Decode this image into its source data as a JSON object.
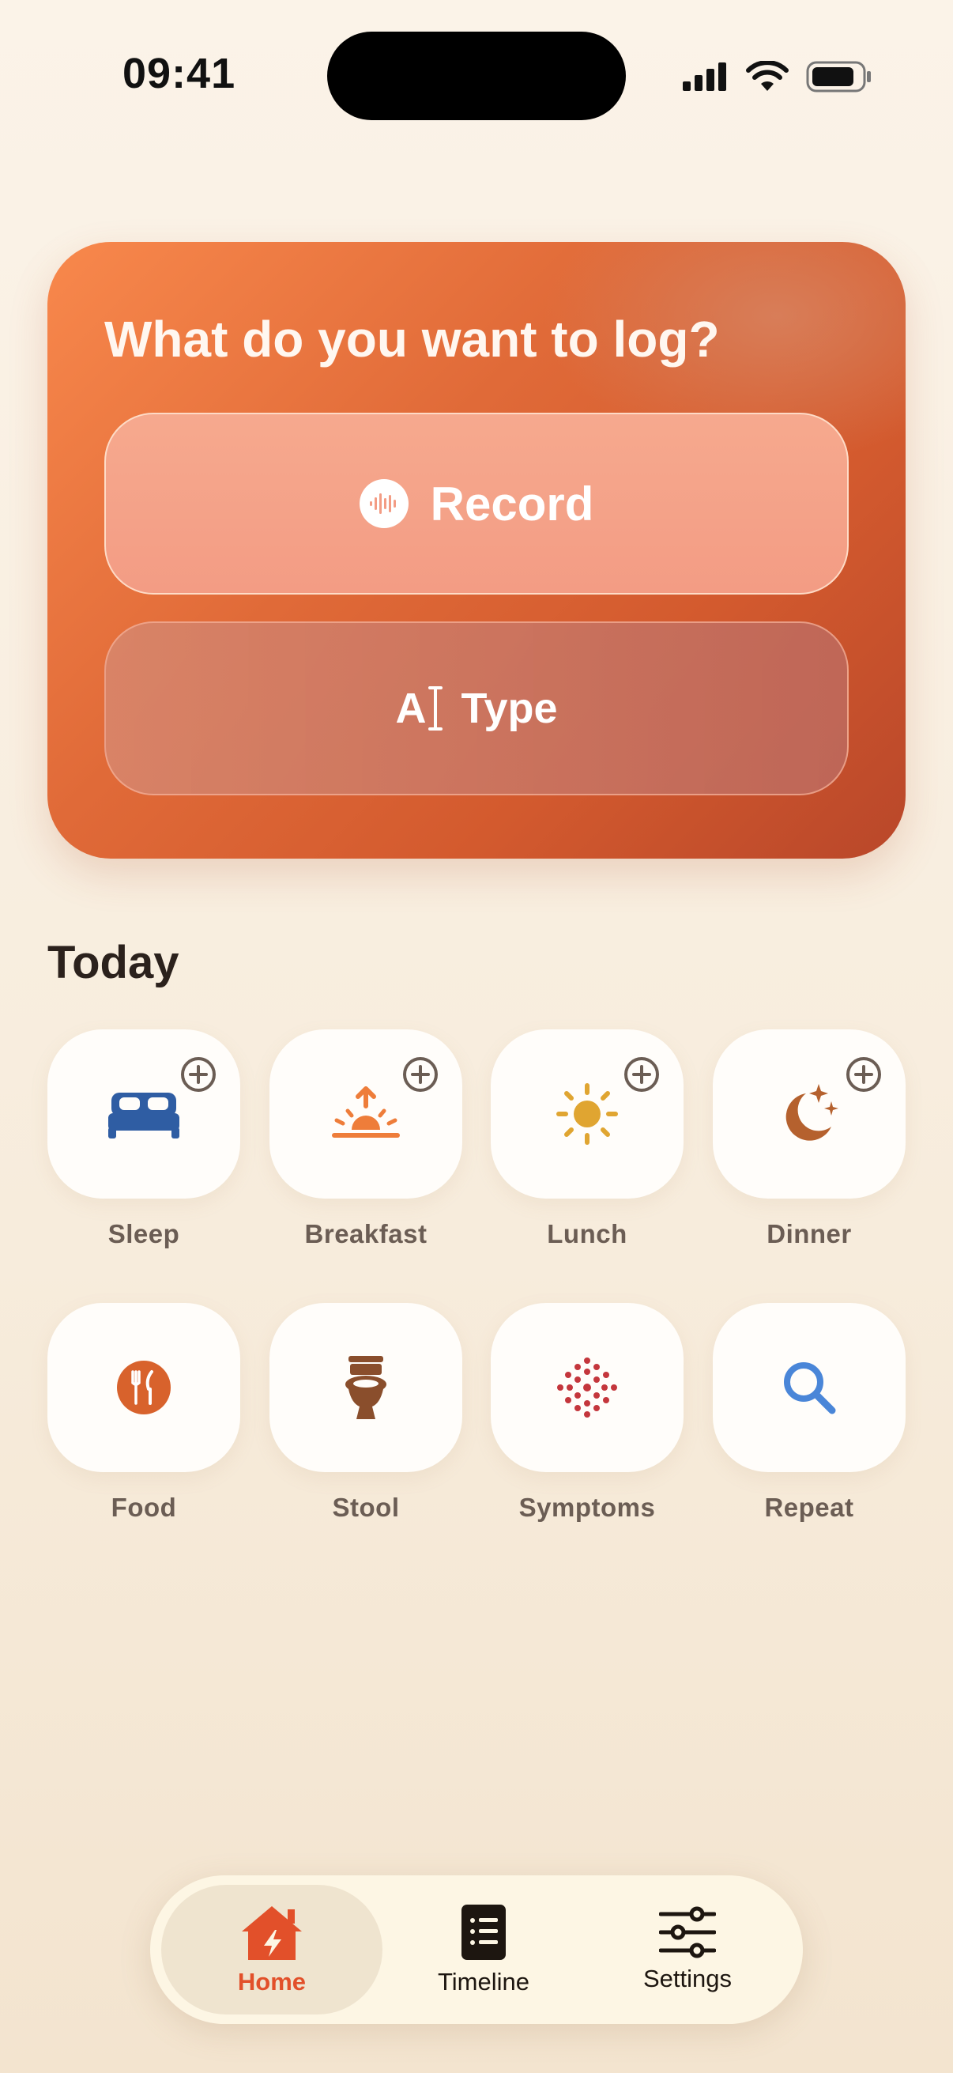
{
  "status_bar": {
    "time": "09:41"
  },
  "log_card": {
    "title": "What do you want to log?",
    "record_label": "Record",
    "type_label": "Type",
    "type_icon_glyph": "A"
  },
  "today": {
    "heading": "Today",
    "tiles": [
      {
        "label": "Sleep",
        "icon": "bed-icon",
        "has_add": true
      },
      {
        "label": "Breakfast",
        "icon": "sunrise-icon",
        "has_add": true
      },
      {
        "label": "Lunch",
        "icon": "sun-icon",
        "has_add": true
      },
      {
        "label": "Dinner",
        "icon": "moon-stars-icon",
        "has_add": true
      },
      {
        "label": "Food",
        "icon": "fork-knife-icon",
        "has_add": false
      },
      {
        "label": "Stool",
        "icon": "toilet-icon",
        "has_add": false
      },
      {
        "label": "Symptoms",
        "icon": "dots-cluster-icon",
        "has_add": false
      },
      {
        "label": "Repeat",
        "icon": "search-icon",
        "has_add": false
      }
    ]
  },
  "tab_bar": {
    "tabs": [
      {
        "label": "Home",
        "icon": "home-bolt-icon",
        "active": true
      },
      {
        "label": "Timeline",
        "icon": "list-book-icon",
        "active": false
      },
      {
        "label": "Settings",
        "icon": "sliders-icon",
        "active": false
      }
    ]
  },
  "colors": {
    "accent": "#e2502a",
    "card_start": "#f8884c",
    "card_end": "#b9472a",
    "sleep_blue": "#2f5da3",
    "breakfast_orange": "#ee7d3a",
    "lunch_yellow": "#e0a531",
    "dinner_brown": "#b5612e",
    "food_orange": "#d8622c",
    "stool_brown": "#8a4e2c",
    "symptoms_red": "#c4363c",
    "repeat_blue": "#4a86d8"
  }
}
